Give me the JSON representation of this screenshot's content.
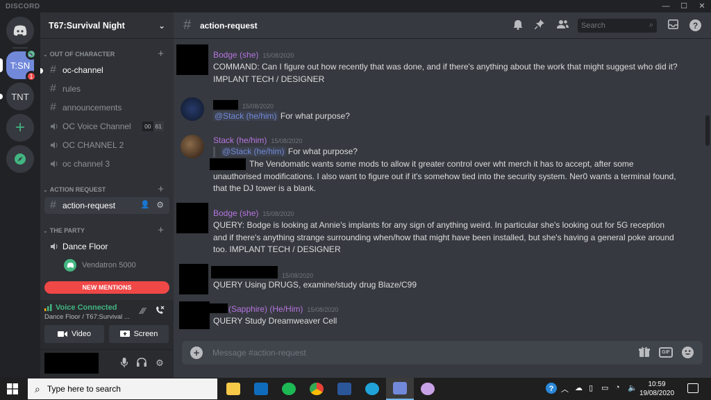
{
  "window": {
    "brand": "DISCORD",
    "controls": [
      "—",
      "☐",
      "✕"
    ]
  },
  "servers": {
    "items": [
      {
        "label": "T:SN",
        "mention_count": "1",
        "voice_badge": "🔊"
      },
      {
        "label": "TNT"
      }
    ],
    "add_label": "+"
  },
  "guild": {
    "name": "T67:Survival Night"
  },
  "categories": {
    "ooc": "OUT OF CHARACTER",
    "action": "ACTION REQUEST",
    "party": "THE PARTY"
  },
  "channels": {
    "oc_channel": "oc-channel",
    "rules": "rules",
    "announcements": "announcements",
    "oc_voice": "OC Voice Channel",
    "oc_voice_users": "00",
    "oc_voice_limit": "61",
    "oc_channel_2": "OC CHANNEL 2",
    "oc_channel_3": "oc channel 3",
    "action_request": "action-request",
    "dance_floor": "Dance Floor",
    "voice_user": "Vendatron 5000"
  },
  "new_mentions": "NEW MENTIONS",
  "voice": {
    "status": "Voice Connected",
    "location": "Dance Floor / T67:Survival ...",
    "video_label": "Video",
    "screen_label": "Screen"
  },
  "header": {
    "channel": "action-request",
    "search_placeholder": "Search"
  },
  "messages": [
    {
      "author": "Bodge (she)",
      "author_color": "#b675e0",
      "time": "15/08/2020",
      "text": "COMMAND: Can I figure out how recently that was done, and if there's anything about the work that might suggest who did it? IMPLANT TECH / DESIGNER"
    },
    {
      "author": "",
      "time": "15/08/2020",
      "mention": "@Stack (he/him)",
      "text": "For what purpose?"
    },
    {
      "author": "Stack (he/him)",
      "author_color": "#b675e0",
      "time": "15/08/2020",
      "quote_mention": "@Stack (he/him)",
      "quote_text": "For what purpose?",
      "text": "The Vendomatic wants some mods to allow it greater control over wht merch it has to accept, after some unauthorised modifications. I also want to figure out if it's somehow tied into the security system. Ner0 wants a terminal found, that the DJ tower is a blank."
    },
    {
      "author": "Bodge (she)",
      "author_color": "#b675e0",
      "time": "15/08/2020",
      "text": "QUERY: Bodge is looking at Annie's implants for any sign of anything weird. In particular she's looking out for 5G reception and if there's anything strange surrounding when/how that might have been installed, but she's having a general poke around too. IMPLANT TECH / DESIGNER"
    },
    {
      "author": "",
      "time": "15/08/2020",
      "text": "QUERY Using DRUGS, examine/study drug Blaze/C99"
    },
    {
      "author": "(Sapphire) (He/Him)",
      "author_color": "#b675e0",
      "time": "15/08/2020",
      "text": "QUERY Study Dreamweaver Cell"
    }
  ],
  "composer": {
    "placeholder": "Message #action-request",
    "gif_label": "GIF"
  },
  "taskbar": {
    "search_placeholder": "Type here to search",
    "time": "10:59",
    "date": "19/08/2020"
  },
  "colors": {
    "accent": "#7289da",
    "online": "#43b581",
    "danger": "#f04747"
  }
}
